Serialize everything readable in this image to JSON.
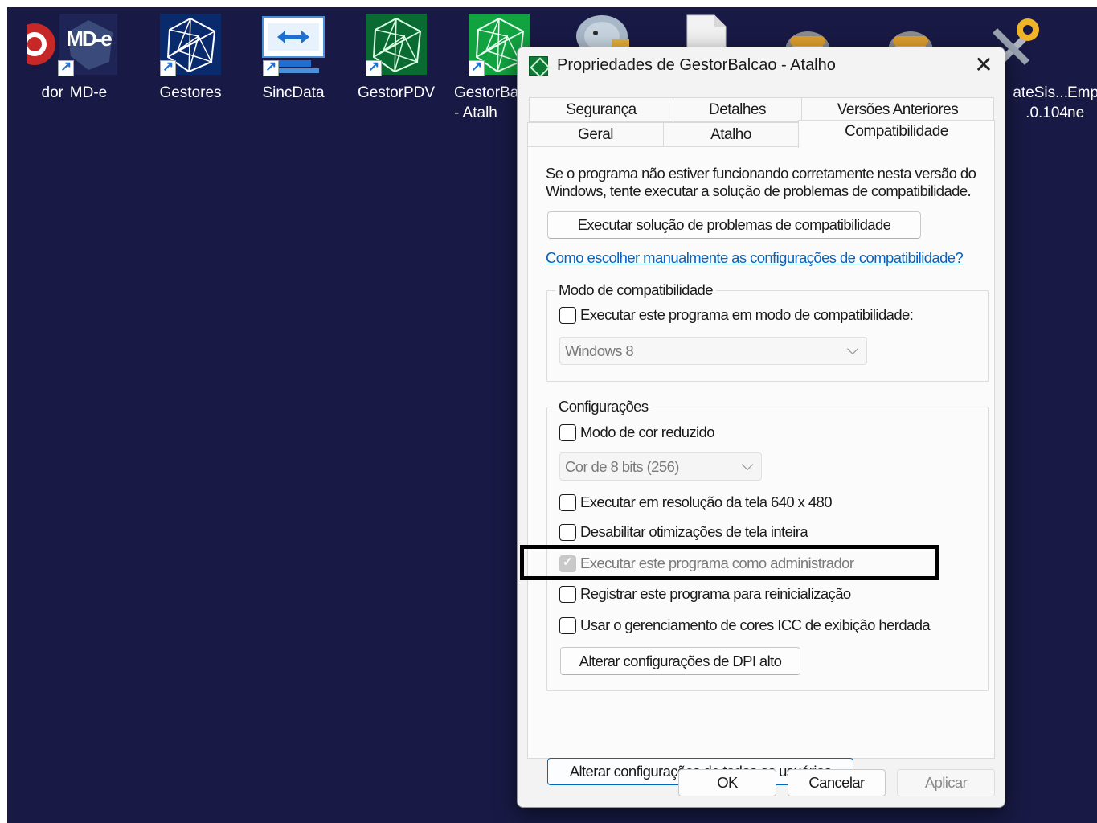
{
  "desktop": {
    "icons": [
      {
        "label": "dor",
        "icon": "red-circle-icon"
      },
      {
        "label": "MD-e",
        "icon": "mde-icon",
        "art_text": "MD-e"
      },
      {
        "label": "Gestores",
        "icon": "network-polygon-icon"
      },
      {
        "label": "SincData",
        "icon": "sync-monitor-icon"
      },
      {
        "label": "GestorPDV",
        "icon": "network-polygon-icon"
      },
      {
        "label": "GestorBa\n- Atalh",
        "icon": "network-polygon-icon"
      },
      {
        "label": "",
        "icon": "elephant-icon"
      },
      {
        "label": "",
        "icon": "blank-file-icon"
      },
      {
        "label": "",
        "icon": "sped-icon"
      },
      {
        "label": "",
        "icon": "sped-icon"
      },
      {
        "label": "ateSis...\n.0.104",
        "icon": "tools-icon"
      },
      {
        "label": "Emp\nne",
        "icon": ""
      }
    ]
  },
  "dialog": {
    "title": "Propriedades de GestorBalcao - Atalho",
    "close_glyph": "✕",
    "tabs_row1": [
      "Segurança",
      "Detalhes",
      "Versões Anteriores"
    ],
    "tabs_row2": [
      "Geral",
      "Atalho",
      "Compatibilidade"
    ],
    "active_tab": "Compatibilidade",
    "intro_line1": "Se o programa não estiver funcionando corretamente nesta versão do",
    "intro_line2": "Windows, tente executar a solução de problemas de compatibilidade.",
    "troubleshooter_button": "Executar solução de problemas de compatibilidade",
    "manual_link": "Como escolher manualmente as configurações de compatibilidade?",
    "compat_mode": {
      "legend": "Modo de compatibilidade",
      "checkbox_label": "Executar este programa em modo de compatibilidade:",
      "checked": false,
      "select_value": "Windows 8"
    },
    "settings": {
      "legend": "Configurações",
      "reduced_color": {
        "label": "Modo de cor reduzido",
        "checked": false
      },
      "color_select_value": "Cor de 8 bits (256)",
      "res_640": {
        "label": "Executar em resolução da tela 640 x 480",
        "checked": false
      },
      "fullscreen_opt": {
        "label": "Desabilitar otimizações de tela inteira",
        "checked": false
      },
      "run_as_admin": {
        "label": "Executar este programa como administrador",
        "checked": true,
        "disabled": true
      },
      "register_restart": {
        "label": "Registrar este programa para reinicialização",
        "checked": false
      },
      "icc_legacy": {
        "label": "Usar o gerenciamento de cores ICC de exibição herdada",
        "checked": false
      },
      "dpi_button": "Alterar configurações de DPI alto"
    },
    "all_users_button": "Alterar configurações de todos os usuários",
    "ok_button": "OK",
    "cancel_button": "Cancelar",
    "apply_button": "Aplicar"
  },
  "colors": {
    "desktop_bg": "#181a45",
    "dialog_bg": "#f3f3f3",
    "link": "#0563c1",
    "accent_button_border": "#0067c0",
    "highlight_box": "#000000"
  }
}
